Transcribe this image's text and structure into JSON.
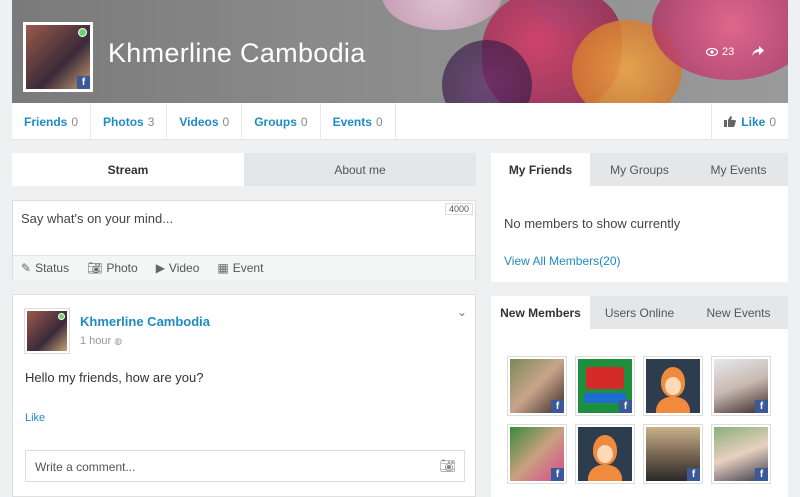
{
  "profile": {
    "name": "Khmerline Cambodia",
    "views": "23"
  },
  "nav_tabs": [
    {
      "label": "Friends",
      "count": "0"
    },
    {
      "label": "Photos",
      "count": "3"
    },
    {
      "label": "Videos",
      "count": "0"
    },
    {
      "label": "Groups",
      "count": "0"
    },
    {
      "label": "Events",
      "count": "0"
    }
  ],
  "like_button": {
    "label": "Like",
    "count": "0"
  },
  "left_tabs": {
    "stream": "Stream",
    "about": "About me"
  },
  "composer": {
    "placeholder": "Say what's on your mind...",
    "limit": "4000",
    "actions": [
      "Status",
      "Photo",
      "Video",
      "Event"
    ]
  },
  "post": {
    "author": "Khmerline Cambodia",
    "time": "1 hour",
    "body": "Hello my friends, how are you?",
    "like_label": "Like",
    "comment_placeholder": "Write a comment..."
  },
  "friends_widget": {
    "tabs": [
      "My Friends",
      "My Groups",
      "My Events"
    ],
    "empty_text": "No members to show currently",
    "view_all": "View All Members(20)"
  },
  "members_widget": {
    "tabs": [
      "New Members",
      "Users Online",
      "New Events"
    ]
  },
  "colors": {
    "link": "#1e8bc3",
    "facebook": "#3b5998",
    "online": "#6ad36a"
  }
}
